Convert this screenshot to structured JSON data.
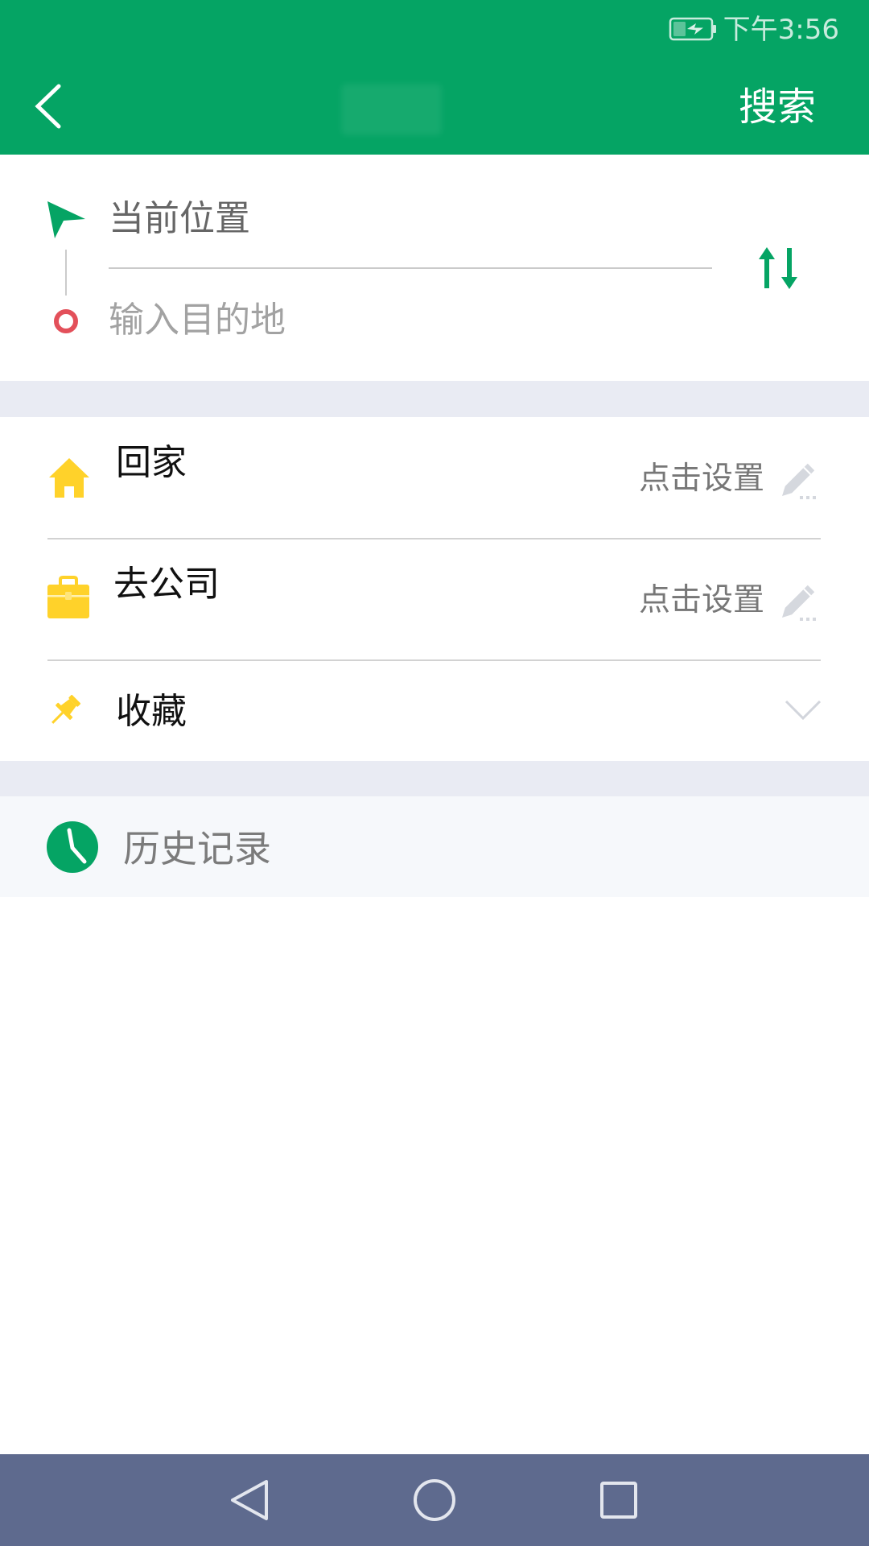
{
  "status_bar": {
    "time": "下午3:56",
    "battery_icon": "battery-charging-icon"
  },
  "header": {
    "back_icon": "chevron-left-icon",
    "search_label": "搜索"
  },
  "route": {
    "origin_icon": "navigation-arrow-icon",
    "origin_value": "当前位置",
    "destination_icon": "destination-ring-icon",
    "destination_placeholder": "输入目的地",
    "swap_icon": "swap-vertical-icon"
  },
  "shortcuts": [
    {
      "label": "回家",
      "icon": "home-icon",
      "action_label": "点击设置",
      "action_icon": "pencil-icon"
    },
    {
      "label": "去公司",
      "icon": "briefcase-icon",
      "action_label": "点击设置",
      "action_icon": "pencil-icon"
    },
    {
      "label": "收藏",
      "icon": "pushpin-icon",
      "expand_icon": "chevron-down-icon"
    }
  ],
  "history": {
    "icon": "clock-icon",
    "label": "历史记录"
  },
  "nav_bar": {
    "back_icon": "back-triangle-icon",
    "home_icon": "home-circle-icon",
    "recents_icon": "recents-square-icon"
  },
  "colors": {
    "primary_green": "#05A464",
    "section_gray": "#E9EBF3",
    "history_background": "#F6F8FB",
    "nav_bar": "#5E6A8E",
    "icon_yellow": "#FFD22A",
    "destination_red": "#E3505A"
  }
}
